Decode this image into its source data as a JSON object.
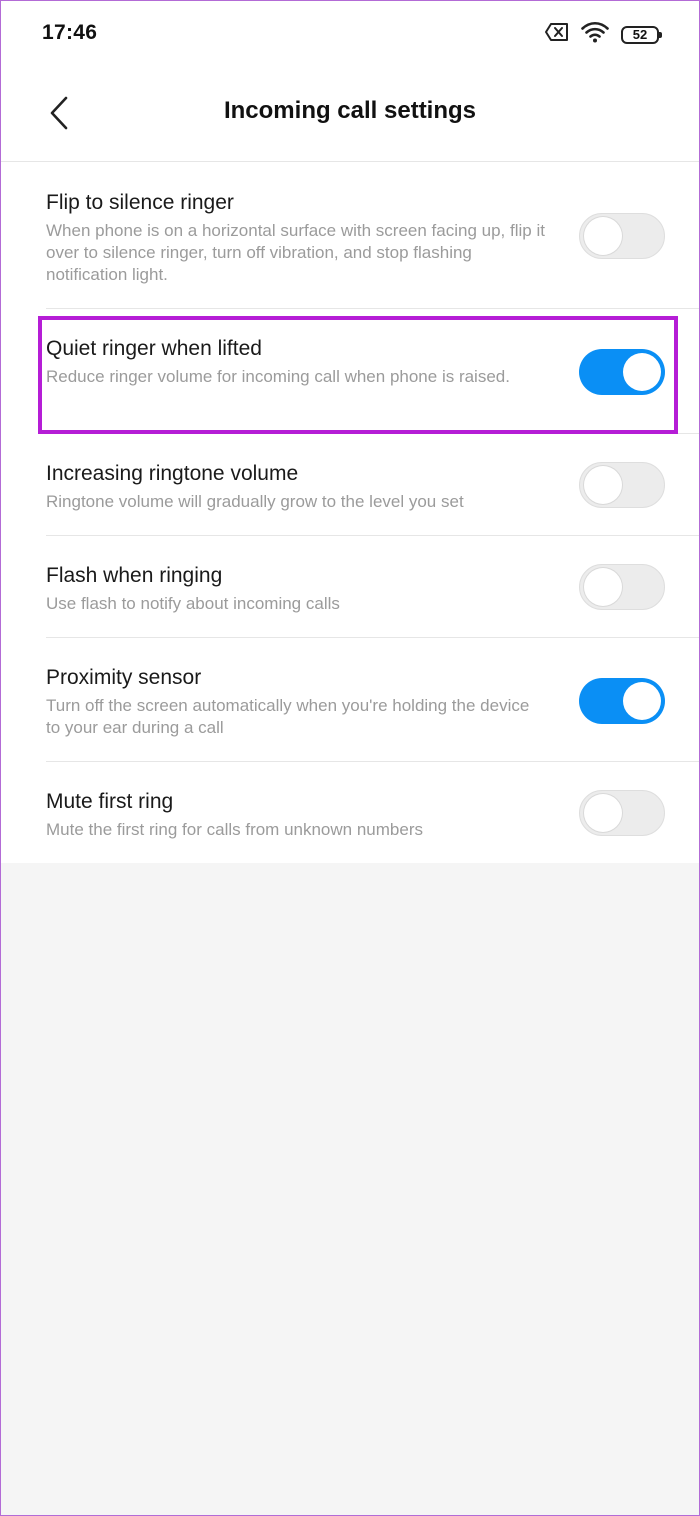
{
  "status_bar": {
    "time": "17:46",
    "battery": "52"
  },
  "header": {
    "title": "Incoming call settings"
  },
  "settings": [
    {
      "title": "Flip to silence ringer",
      "description": "When phone is on a horizontal surface with screen facing up, flip it over to silence ringer, turn off vibration, and stop flashing notification light.",
      "enabled": false
    },
    {
      "title": "Quiet ringer when lifted",
      "description": "Reduce ringer volume for incoming call when phone is raised.",
      "enabled": true,
      "highlighted": true
    },
    {
      "title": "Increasing ringtone volume",
      "description": "Ringtone volume will gradually grow to the level you set",
      "enabled": false
    },
    {
      "title": "Flash when ringing",
      "description": "Use flash to notify about incoming calls",
      "enabled": false
    },
    {
      "title": "Proximity sensor",
      "description": "Turn off the screen automatically when you're holding the device to your ear during a call",
      "enabled": true
    },
    {
      "title": "Mute first ring",
      "description": "Mute the first ring for calls from unknown numbers",
      "enabled": false
    }
  ],
  "colors": {
    "toggle_on": "#0a8ff5",
    "toggle_off": "#ececec",
    "highlight": "#b51dd6"
  }
}
